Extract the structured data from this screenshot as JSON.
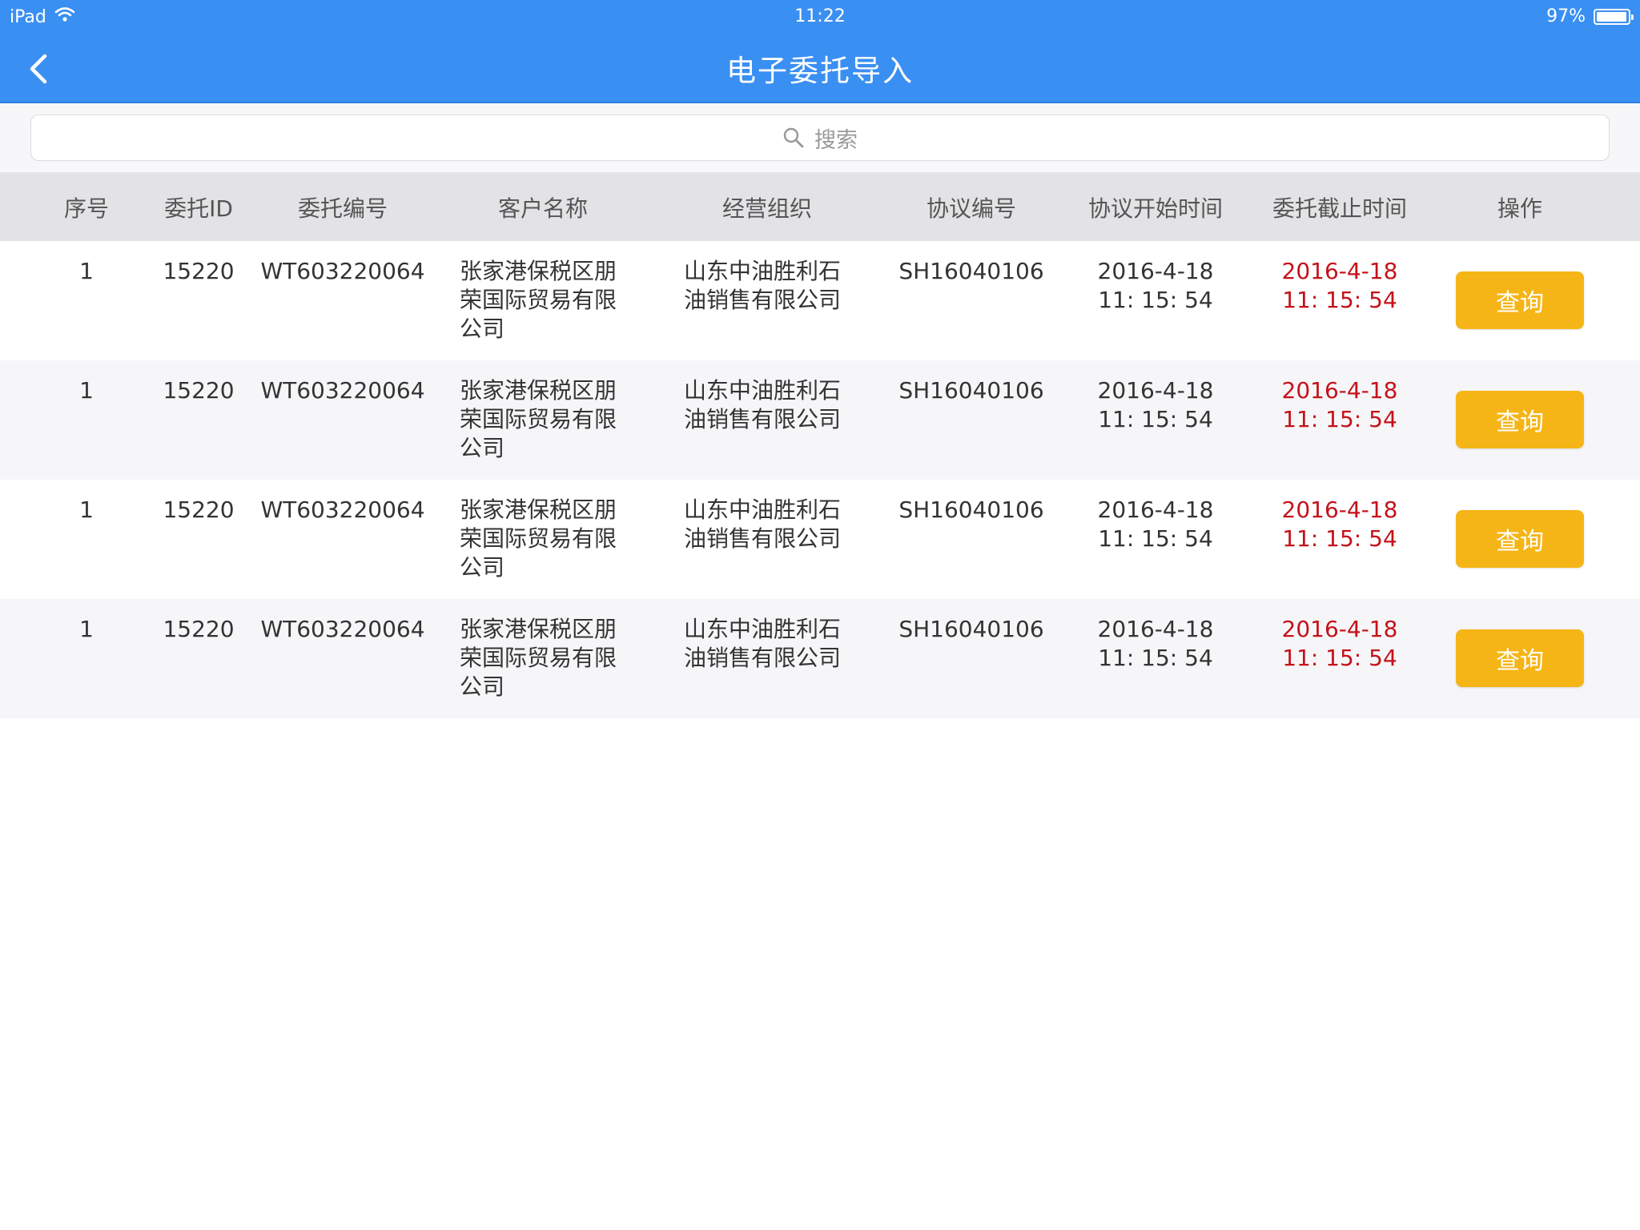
{
  "status": {
    "device": "iPad",
    "time": "11:22",
    "battery": "97%",
    "battery_level": 0.97
  },
  "nav": {
    "title": "电子委托导入"
  },
  "search": {
    "placeholder": "搜索"
  },
  "table": {
    "headers": [
      "序号",
      "委托ID",
      "委托编号",
      "客户名称",
      "经营组织",
      "协议编号",
      "协议开始时间",
      "委托截止时间",
      "操作"
    ],
    "rows": [
      {
        "seq": "1",
        "id": "15220",
        "code": "WT603220064",
        "customer": [
          "张家港保税区朋",
          "荣国际贸易有限",
          "公司"
        ],
        "org": [
          "山东中油胜利石",
          "油销售有限公司"
        ],
        "agreement": "SH16040106",
        "start_date": "2016-4-18",
        "start_time": "11: 15: 54",
        "end_date": "2016-4-18",
        "end_time": "11: 15: 54",
        "action": "查询"
      },
      {
        "seq": "1",
        "id": "15220",
        "code": "WT603220064",
        "customer": [
          "张家港保税区朋",
          "荣国际贸易有限",
          "公司"
        ],
        "org": [
          "山东中油胜利石",
          "油销售有限公司"
        ],
        "agreement": "SH16040106",
        "start_date": "2016-4-18",
        "start_time": "11: 15: 54",
        "end_date": "2016-4-18",
        "end_time": "11: 15: 54",
        "action": "查询"
      },
      {
        "seq": "1",
        "id": "15220",
        "code": "WT603220064",
        "customer": [
          "张家港保税区朋",
          "荣国际贸易有限",
          "公司"
        ],
        "org": [
          "山东中油胜利石",
          "油销售有限公司"
        ],
        "agreement": "SH16040106",
        "start_date": "2016-4-18",
        "start_time": "11: 15: 54",
        "end_date": "2016-4-18",
        "end_time": "11: 15: 54",
        "action": "查询"
      },
      {
        "seq": "1",
        "id": "15220",
        "code": "WT603220064",
        "customer": [
          "张家港保税区朋",
          "荣国际贸易有限",
          "公司"
        ],
        "org": [
          "山东中油胜利石",
          "油销售有限公司"
        ],
        "agreement": "SH16040106",
        "start_date": "2016-4-18",
        "start_time": "11: 15: 54",
        "end_date": "2016-4-18",
        "end_time": "11: 15: 54",
        "action": "查询"
      }
    ]
  },
  "colors": {
    "nav_bg": "#3a8ff2",
    "button_bg": "#f6b516",
    "deadline_text": "#c4121a",
    "header_bg": "#e3e3e6"
  },
  "icons": {
    "back": "chevron-left-icon",
    "search": "search-icon",
    "wifi": "wifi-icon",
    "battery": "battery-icon"
  }
}
